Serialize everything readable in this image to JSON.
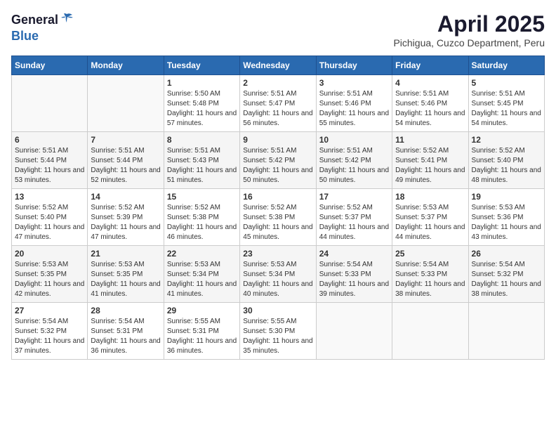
{
  "header": {
    "logo_general": "General",
    "logo_blue": "Blue",
    "month_title": "April 2025",
    "location": "Pichigua, Cuzco Department, Peru"
  },
  "days_of_week": [
    "Sunday",
    "Monday",
    "Tuesday",
    "Wednesday",
    "Thursday",
    "Friday",
    "Saturday"
  ],
  "weeks": [
    [
      {
        "day": "",
        "info": ""
      },
      {
        "day": "",
        "info": ""
      },
      {
        "day": "1",
        "info": "Sunrise: 5:50 AM\nSunset: 5:48 PM\nDaylight: 11 hours and 57 minutes."
      },
      {
        "day": "2",
        "info": "Sunrise: 5:51 AM\nSunset: 5:47 PM\nDaylight: 11 hours and 56 minutes."
      },
      {
        "day": "3",
        "info": "Sunrise: 5:51 AM\nSunset: 5:46 PM\nDaylight: 11 hours and 55 minutes."
      },
      {
        "day": "4",
        "info": "Sunrise: 5:51 AM\nSunset: 5:46 PM\nDaylight: 11 hours and 54 minutes."
      },
      {
        "day": "5",
        "info": "Sunrise: 5:51 AM\nSunset: 5:45 PM\nDaylight: 11 hours and 54 minutes."
      }
    ],
    [
      {
        "day": "6",
        "info": "Sunrise: 5:51 AM\nSunset: 5:44 PM\nDaylight: 11 hours and 53 minutes."
      },
      {
        "day": "7",
        "info": "Sunrise: 5:51 AM\nSunset: 5:44 PM\nDaylight: 11 hours and 52 minutes."
      },
      {
        "day": "8",
        "info": "Sunrise: 5:51 AM\nSunset: 5:43 PM\nDaylight: 11 hours and 51 minutes."
      },
      {
        "day": "9",
        "info": "Sunrise: 5:51 AM\nSunset: 5:42 PM\nDaylight: 11 hours and 50 minutes."
      },
      {
        "day": "10",
        "info": "Sunrise: 5:51 AM\nSunset: 5:42 PM\nDaylight: 11 hours and 50 minutes."
      },
      {
        "day": "11",
        "info": "Sunrise: 5:52 AM\nSunset: 5:41 PM\nDaylight: 11 hours and 49 minutes."
      },
      {
        "day": "12",
        "info": "Sunrise: 5:52 AM\nSunset: 5:40 PM\nDaylight: 11 hours and 48 minutes."
      }
    ],
    [
      {
        "day": "13",
        "info": "Sunrise: 5:52 AM\nSunset: 5:40 PM\nDaylight: 11 hours and 47 minutes."
      },
      {
        "day": "14",
        "info": "Sunrise: 5:52 AM\nSunset: 5:39 PM\nDaylight: 11 hours and 47 minutes."
      },
      {
        "day": "15",
        "info": "Sunrise: 5:52 AM\nSunset: 5:38 PM\nDaylight: 11 hours and 46 minutes."
      },
      {
        "day": "16",
        "info": "Sunrise: 5:52 AM\nSunset: 5:38 PM\nDaylight: 11 hours and 45 minutes."
      },
      {
        "day": "17",
        "info": "Sunrise: 5:52 AM\nSunset: 5:37 PM\nDaylight: 11 hours and 44 minutes."
      },
      {
        "day": "18",
        "info": "Sunrise: 5:53 AM\nSunset: 5:37 PM\nDaylight: 11 hours and 44 minutes."
      },
      {
        "day": "19",
        "info": "Sunrise: 5:53 AM\nSunset: 5:36 PM\nDaylight: 11 hours and 43 minutes."
      }
    ],
    [
      {
        "day": "20",
        "info": "Sunrise: 5:53 AM\nSunset: 5:35 PM\nDaylight: 11 hours and 42 minutes."
      },
      {
        "day": "21",
        "info": "Sunrise: 5:53 AM\nSunset: 5:35 PM\nDaylight: 11 hours and 41 minutes."
      },
      {
        "day": "22",
        "info": "Sunrise: 5:53 AM\nSunset: 5:34 PM\nDaylight: 11 hours and 41 minutes."
      },
      {
        "day": "23",
        "info": "Sunrise: 5:53 AM\nSunset: 5:34 PM\nDaylight: 11 hours and 40 minutes."
      },
      {
        "day": "24",
        "info": "Sunrise: 5:54 AM\nSunset: 5:33 PM\nDaylight: 11 hours and 39 minutes."
      },
      {
        "day": "25",
        "info": "Sunrise: 5:54 AM\nSunset: 5:33 PM\nDaylight: 11 hours and 38 minutes."
      },
      {
        "day": "26",
        "info": "Sunrise: 5:54 AM\nSunset: 5:32 PM\nDaylight: 11 hours and 38 minutes."
      }
    ],
    [
      {
        "day": "27",
        "info": "Sunrise: 5:54 AM\nSunset: 5:32 PM\nDaylight: 11 hours and 37 minutes."
      },
      {
        "day": "28",
        "info": "Sunrise: 5:54 AM\nSunset: 5:31 PM\nDaylight: 11 hours and 36 minutes."
      },
      {
        "day": "29",
        "info": "Sunrise: 5:55 AM\nSunset: 5:31 PM\nDaylight: 11 hours and 36 minutes."
      },
      {
        "day": "30",
        "info": "Sunrise: 5:55 AM\nSunset: 5:30 PM\nDaylight: 11 hours and 35 minutes."
      },
      {
        "day": "",
        "info": ""
      },
      {
        "day": "",
        "info": ""
      },
      {
        "day": "",
        "info": ""
      }
    ]
  ]
}
